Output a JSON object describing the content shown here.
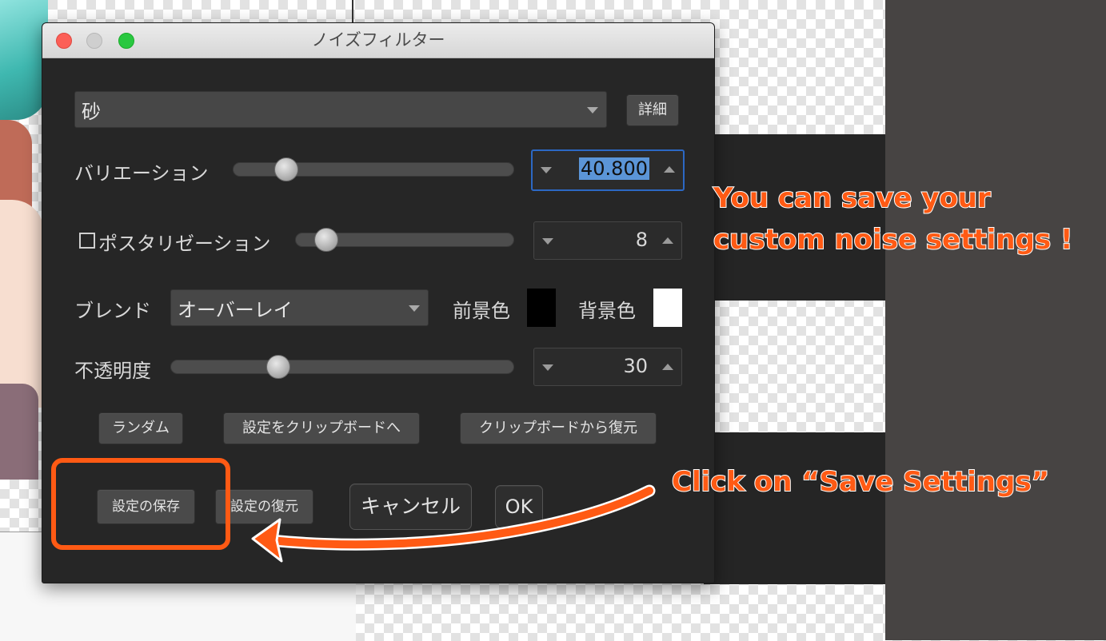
{
  "window": {
    "title": "ノイズフィルター"
  },
  "noise_type": {
    "value": "砂",
    "details_label": "詳細"
  },
  "variation": {
    "label": "バリエーション",
    "value": "40.800",
    "level": 0.2
  },
  "posterize": {
    "label": "ポスタリゼーション",
    "checked": false,
    "value": "8",
    "level": 0.15
  },
  "blend": {
    "label": "ブレンド",
    "value": "オーバーレイ",
    "fg_label": "前景色",
    "fg_color": "#000000",
    "bg_label": "背景色",
    "bg_color": "#ffffff"
  },
  "opacity": {
    "label": "不透明度",
    "value": "30",
    "level": 0.3
  },
  "buttons": {
    "random": "ランダム",
    "copy_to_clipboard": "設定をクリップボードへ",
    "restore_from_clipboard": "クリップボードから復元",
    "save_settings": "設定の保存",
    "restore_settings": "設定の復元",
    "cancel": "キャンセル",
    "ok": "OK"
  },
  "annotations": {
    "note_line1": "You can save your",
    "note_line2": "custom noise settings !",
    "click_note": "Click on “Save Settings”",
    "accent_color": "#ff5a14"
  }
}
